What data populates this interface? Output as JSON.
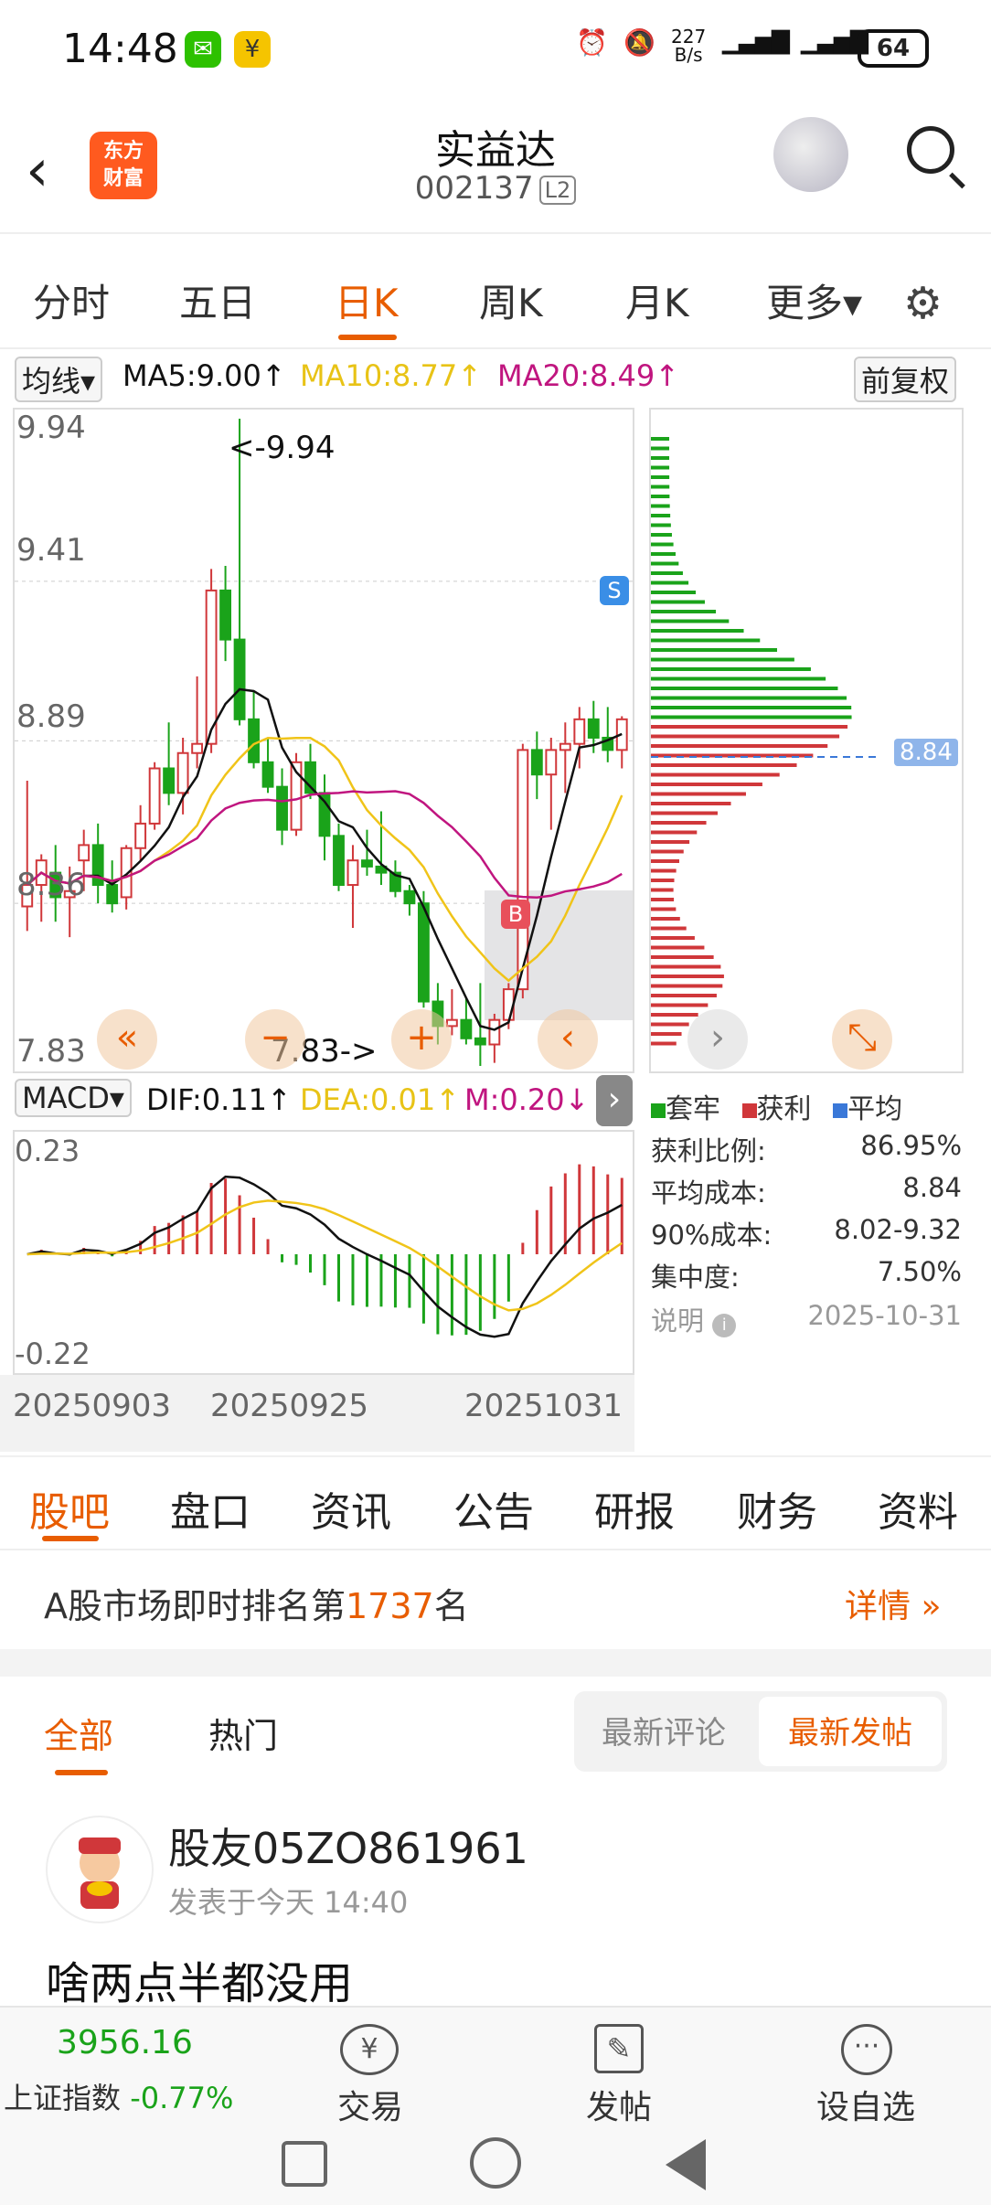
{
  "status": {
    "time": "14:48",
    "net_speed": "227\nB/s",
    "net_speed_top": "227",
    "net_speed_bottom": "B/s",
    "battery": "64",
    "app_icons": [
      "wechat-icon",
      "yuan-app-icon"
    ]
  },
  "header": {
    "logo_line1": "东方",
    "logo_line2": "财富",
    "title": "实益达",
    "code": "002137",
    "level": "L2"
  },
  "periods": {
    "tabs": [
      "分时",
      "五日",
      "日K",
      "周K",
      "月K",
      "更多▾"
    ],
    "active": "日K"
  },
  "legend": {
    "type": "均线▾",
    "ma5": "MA5:9.00↑",
    "ma10": "MA10:8.77↑",
    "ma20": "MA20:8.49↑",
    "adjust": "前复权"
  },
  "price_axis": {
    "p1": "9.94",
    "p2": "9.41",
    "p3": "8.89",
    "p4": "8.36",
    "p5": "7.83"
  },
  "annotations": {
    "high": "<-9.94",
    "low": "7.83->",
    "sell": "S",
    "buy": "B",
    "avg_cost_tag": "8.84"
  },
  "macd": {
    "type": "MACD▾",
    "dif": "DIF:0.11↑",
    "dea": "DEA:0.01↑",
    "m": "M:0.20↓",
    "top": "0.23",
    "bottom": "-0.22"
  },
  "dates": {
    "d1": "20250903",
    "d2": "20250925",
    "d3": "20251031"
  },
  "distribution": {
    "legend": [
      "套牢",
      "获利",
      "平均"
    ],
    "rows": [
      {
        "label": "获利比例:",
        "value": "86.95%"
      },
      {
        "label": "平均成本:",
        "value": "8.84"
      },
      {
        "label": "90%成本:",
        "value": "8.02-9.32"
      },
      {
        "label": "集中度:",
        "value": "7.50%"
      }
    ],
    "note_label": "说明",
    "note_date": "2025-10-31"
  },
  "colors": {
    "accent": "#e85d00",
    "up": "#d0373a",
    "down": "#1aa31a",
    "ma5": "#111111",
    "ma10": "#f0c419",
    "ma20": "#c0157f",
    "avg": "#3a78d8"
  },
  "tabs2": {
    "items": [
      "股吧",
      "盘口",
      "资讯",
      "公告",
      "研报",
      "财务",
      "资料"
    ],
    "active": "股吧"
  },
  "rank": {
    "prefix": "A股市场即时排名第",
    "number": "1737",
    "suffix": "名",
    "details": "详情 »"
  },
  "feed": {
    "tab_all": "全部",
    "tab_hot": "热门",
    "sort_latest_comment": "最新评论",
    "sort_latest_post": "最新发帖"
  },
  "post": {
    "user": "股友05ZO861961",
    "time": "发表于今天 14:40",
    "content": "啥两点半都没用"
  },
  "bottom": {
    "index_value": "3956.16",
    "index_name": "上证指数",
    "index_change": "-0.77%",
    "trade": "交易",
    "post": "发帖",
    "watch": "设自选"
  },
  "chart_data": {
    "type": "candlestick",
    "ohlc": [
      [
        8.35,
        8.76,
        8.27,
        8.42
      ],
      [
        8.42,
        8.52,
        8.3,
        8.5
      ],
      [
        8.46,
        8.55,
        8.3,
        8.38
      ],
      [
        8.38,
        8.48,
        8.25,
        8.4
      ],
      [
        8.5,
        8.6,
        8.4,
        8.55
      ],
      [
        8.55,
        8.62,
        8.36,
        8.42
      ],
      [
        8.42,
        8.5,
        8.33,
        8.36
      ],
      [
        8.38,
        8.55,
        8.34,
        8.54
      ],
      [
        8.54,
        8.68,
        8.5,
        8.62
      ],
      [
        8.62,
        8.82,
        8.6,
        8.8
      ],
      [
        8.8,
        8.95,
        8.68,
        8.72
      ],
      [
        8.72,
        8.9,
        8.65,
        8.85
      ],
      [
        8.85,
        9.1,
        8.8,
        8.88
      ],
      [
        8.88,
        9.45,
        8.85,
        9.38
      ],
      [
        9.38,
        9.46,
        9.15,
        9.22
      ],
      [
        9.22,
        9.94,
        8.94,
        8.96
      ],
      [
        8.96,
        9.05,
        8.8,
        8.82
      ],
      [
        8.82,
        8.9,
        8.72,
        8.74
      ],
      [
        8.74,
        8.8,
        8.55,
        8.6
      ],
      [
        8.6,
        8.85,
        8.58,
        8.82
      ],
      [
        8.82,
        8.88,
        8.7,
        8.72
      ],
      [
        8.72,
        8.78,
        8.5,
        8.58
      ],
      [
        8.58,
        8.62,
        8.4,
        8.42
      ],
      [
        8.42,
        8.55,
        8.28,
        8.5
      ],
      [
        8.5,
        8.6,
        8.45,
        8.48
      ],
      [
        8.48,
        8.66,
        8.42,
        8.46
      ],
      [
        8.46,
        8.5,
        8.38,
        8.4
      ],
      [
        8.4,
        8.42,
        8.32,
        8.36
      ],
      [
        8.36,
        8.4,
        8.02,
        8.04
      ],
      [
        8.04,
        8.1,
        7.9,
        7.96
      ],
      [
        7.96,
        8.08,
        7.93,
        7.98
      ],
      [
        7.98,
        8.05,
        7.9,
        7.92
      ],
      [
        7.92,
        8.1,
        7.83,
        7.9
      ],
      [
        7.9,
        8.0,
        7.84,
        7.98
      ],
      [
        7.98,
        8.1,
        7.95,
        8.08
      ],
      [
        8.08,
        8.88,
        8.05,
        8.86
      ],
      [
        8.86,
        8.92,
        8.7,
        8.78
      ],
      [
        8.78,
        8.9,
        8.6,
        8.86
      ],
      [
        8.86,
        8.95,
        8.72,
        8.88
      ],
      [
        8.88,
        9.0,
        8.8,
        8.96
      ],
      [
        8.96,
        9.02,
        8.85,
        8.9
      ],
      [
        8.9,
        9.0,
        8.82,
        8.86
      ],
      [
        8.86,
        8.97,
        8.8,
        8.96
      ]
    ],
    "ylim": [
      7.83,
      9.94
    ]
  }
}
